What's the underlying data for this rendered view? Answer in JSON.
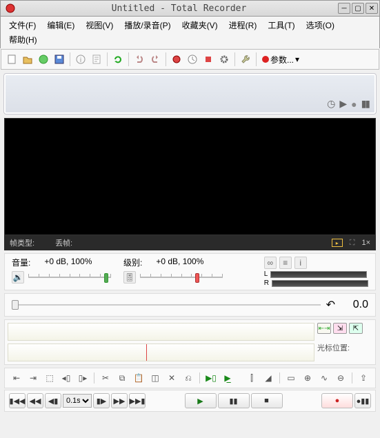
{
  "window": {
    "title": "Untitled - Total Recorder"
  },
  "menu": {
    "file": "文件(F)",
    "edit": "编辑(E)",
    "view": "视图(V)",
    "play": "播放/录音(P)",
    "fav": "收藏夹(V)",
    "process": "进程(R)",
    "tools": "工具(T)",
    "options": "选项(O)",
    "help": "帮助(H)"
  },
  "toolbar": {
    "params_label": "参数..."
  },
  "video_status": {
    "type_label": "帧类型:",
    "drop_label": "丢帧:",
    "zoom": "1×"
  },
  "volume": {
    "vol_label": "音量:",
    "vol_value": "+0 dB, 100%",
    "lvl_label": "级别:",
    "lvl_value": "+0 dB, 100%",
    "L": "L",
    "R": "R"
  },
  "seek": {
    "undo_icon": "↶",
    "pos": "0.0"
  },
  "wave": {
    "cursor_label": "光标位置:"
  },
  "playbar": {
    "step": "0.1s"
  }
}
